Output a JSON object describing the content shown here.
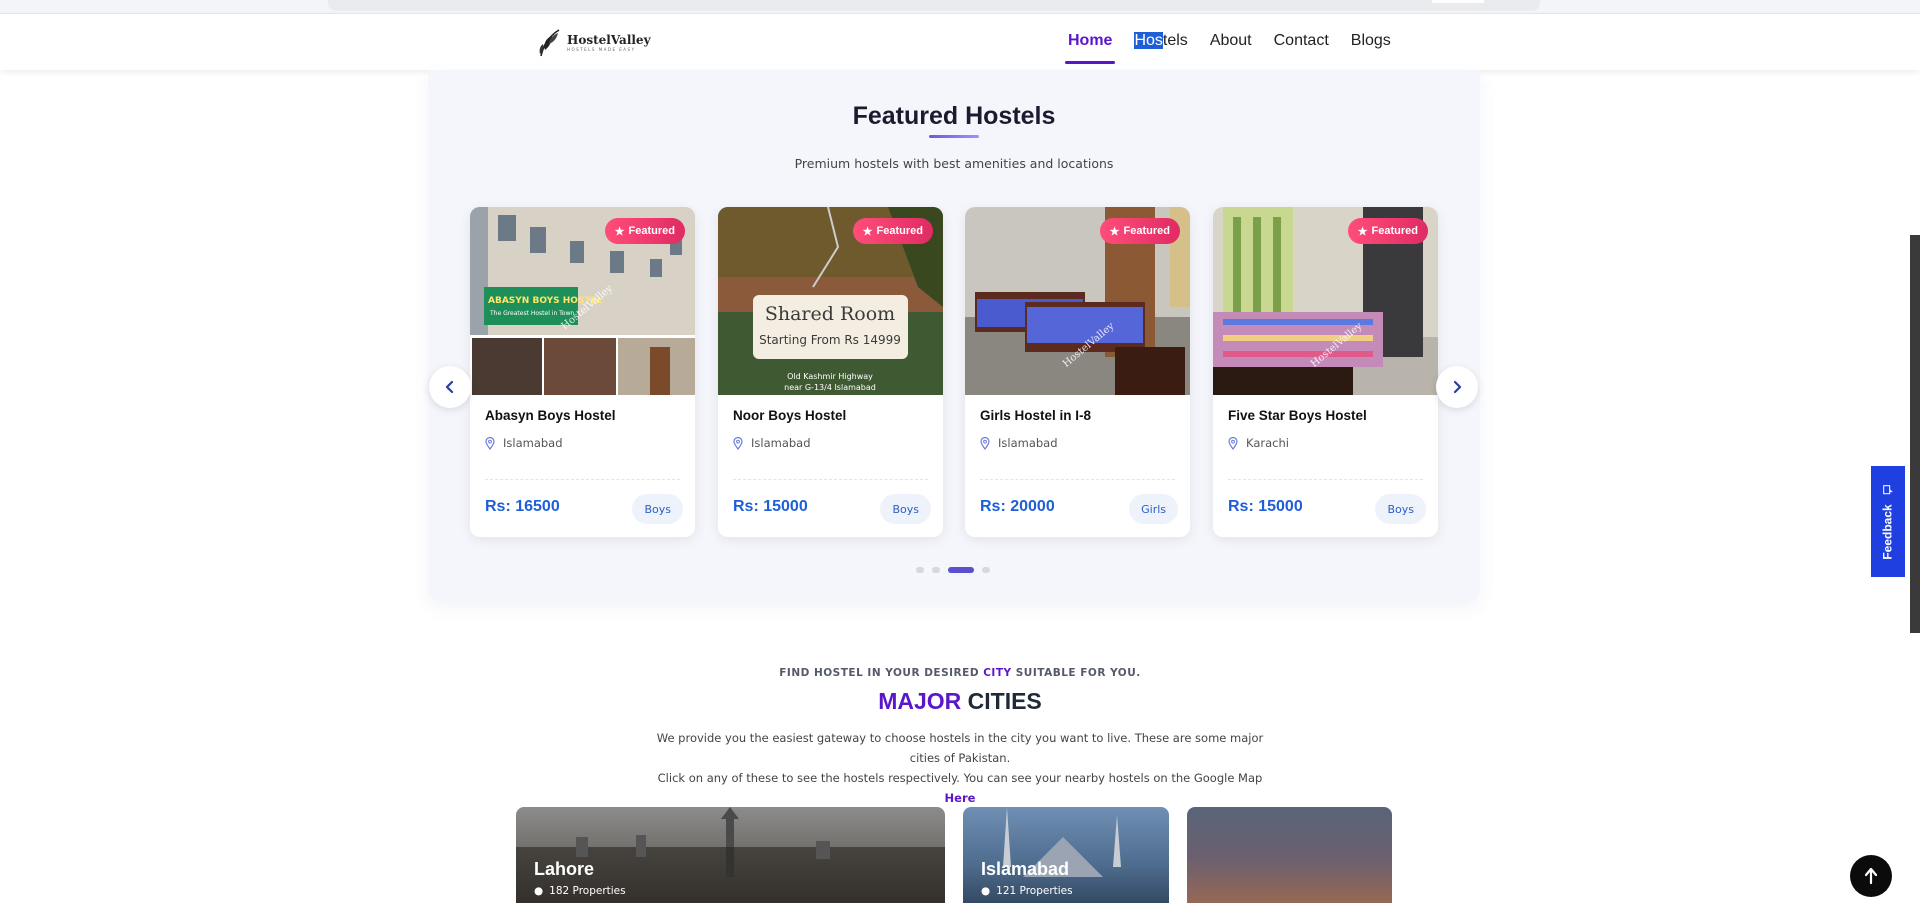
{
  "header": {
    "logo_name": "HostelValley",
    "logo_tagline": "HOSTELS MADE EASY",
    "nav": [
      {
        "label": "Home",
        "active": true
      },
      {
        "label_selected": "Hos",
        "label_rest": "tels",
        "active": false
      },
      {
        "label": "About",
        "active": false
      },
      {
        "label": "Contact",
        "active": false
      },
      {
        "label": "Blogs",
        "active": false
      }
    ]
  },
  "featured": {
    "title": "Featured Hostels",
    "subtitle": "Premium hostels with best amenities and locations",
    "badge_label": "Featured",
    "cards": [
      {
        "name": "Abasyn Boys Hostel",
        "city": "Islamabad",
        "price": "Rs: 16500",
        "type": "Boys",
        "sign_title": "ABASYN BOYS HOSTEL",
        "sign_sub": "The Greatest Hostel in Town",
        "watermark": "HostelValley"
      },
      {
        "name": "Noor Boys Hostel",
        "city": "Islamabad",
        "price": "Rs: 15000",
        "type": "Boys",
        "img_title": "Shared Room",
        "img_sub": "Starting From Rs 14999",
        "img_addr1": "Old Kashmir Highway",
        "img_addr2": "near G-13/4 Islamabad"
      },
      {
        "name": "Girls Hostel in I-8",
        "city": "Islamabad",
        "price": "Rs: 20000",
        "type": "Girls",
        "watermark": "HostelValley"
      },
      {
        "name": "Five Star Boys Hostel",
        "city": "Karachi",
        "price": "Rs: 15000",
        "type": "Boys",
        "watermark": "HostelValley"
      }
    ],
    "active_dot": 2,
    "dot_count": 4
  },
  "cities_section": {
    "eyebrow_pre": "FIND HOSTEL IN YOUR DESIRED ",
    "eyebrow_hl": "CITY",
    "eyebrow_post": " SUITABLE FOR YOU.",
    "title_hl": "MAJOR",
    "title_rest": " CITIES",
    "desc_line1": "We provide you the easiest gateway to choose hostels in the city you want to live. These are some major cities of Pakistan.",
    "desc_line2": "Click on any of these to see the hostels respectively. You can see your nearby hostels on the Google Map ",
    "desc_link": "Here",
    "cities": [
      {
        "name": "Lahore",
        "props": "182 Properties"
      },
      {
        "name": "Islamabad",
        "props": "121 Properties"
      },
      {
        "name": "",
        "props": ""
      }
    ]
  },
  "widgets": {
    "feedback_label": "Feedback"
  },
  "colors": {
    "accent": "#5b16c9",
    "price_blue": "#1e5fd8",
    "badge_pink": "#e02b63",
    "feedback_blue": "#1f3fe0"
  }
}
